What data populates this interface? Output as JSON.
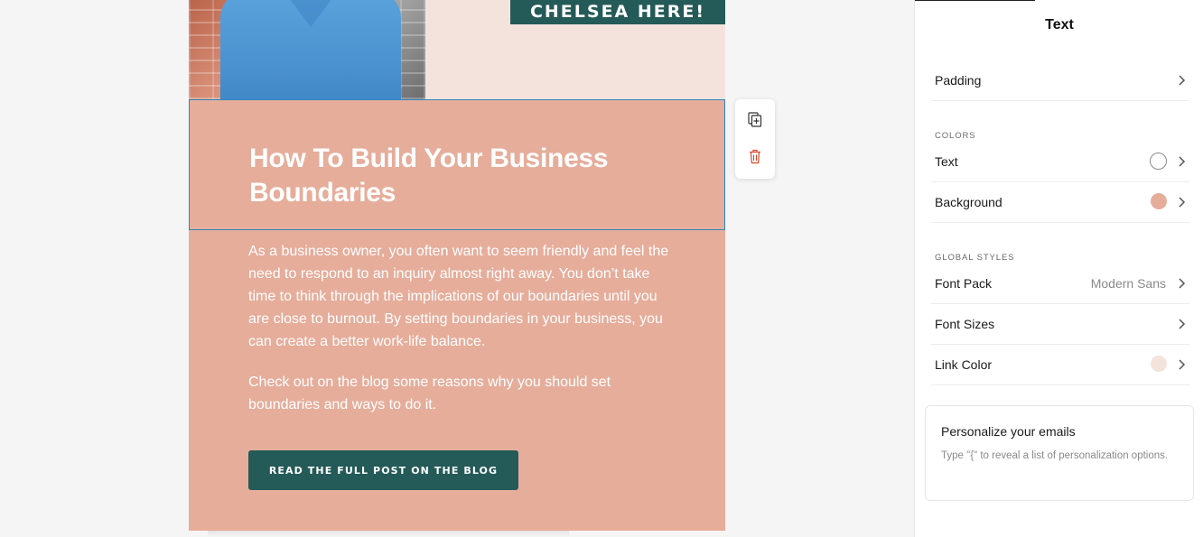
{
  "email": {
    "hero_badge": "CHELSEA HERE!",
    "title": "How To Build Your Business Boundaries",
    "paragraphs": [
      "As a business owner, you often want to seem friendly and feel the need to respond to an inquiry almost right away. You don’t take time to think through the implications of our boundaries until you are close to burnout. By setting boundaries in your business, you can create a better work-life balance.",
      "Check out on the blog some reasons why you should set boundaries and ways to do it."
    ],
    "cta_label": "READ THE FULL POST ON THE BLOG",
    "colors": {
      "block_background": "#e6ad9b",
      "accent": "#245a57",
      "hero_background": "#f4e3dd",
      "selection": "#2e86c1"
    }
  },
  "block_toolbar": {
    "icons": [
      "duplicate-icon",
      "trash-icon"
    ]
  },
  "panel": {
    "title": "Text",
    "padding_label": "Padding",
    "colors_section": "COLORS",
    "text_color_label": "Text",
    "text_color": "#ffffff",
    "background_label": "Background",
    "background_color": "#e6ad9b",
    "global_styles_section": "GLOBAL STYLES",
    "font_pack_label": "Font Pack",
    "font_pack_value": "Modern Sans",
    "font_sizes_label": "Font Sizes",
    "link_color_label": "Link Color",
    "link_color": "#f4e3dd",
    "personalize": {
      "title": "Personalize your emails",
      "hint": "Type \"{\" to reveal a list of personalization options."
    }
  }
}
